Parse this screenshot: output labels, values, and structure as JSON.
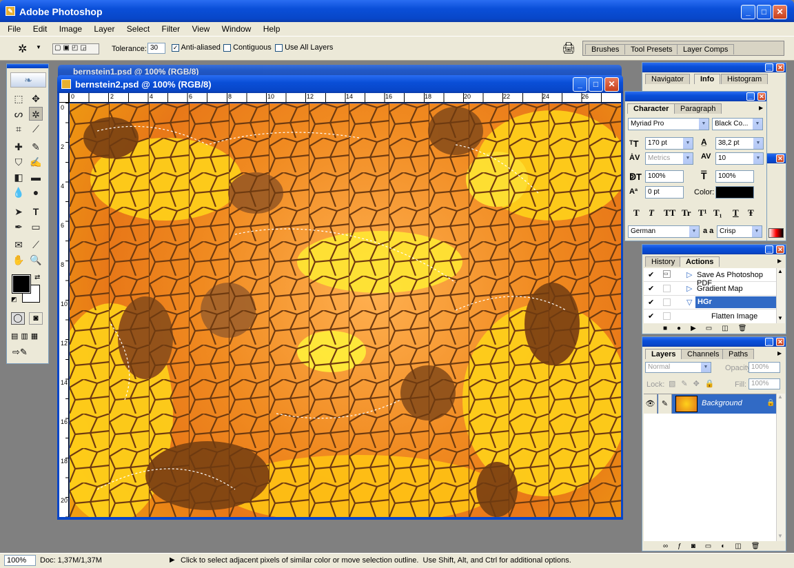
{
  "app": {
    "title": "Adobe Photoshop"
  },
  "menu": [
    "File",
    "Edit",
    "Image",
    "Layer",
    "Select",
    "Filter",
    "View",
    "Window",
    "Help"
  ],
  "options": {
    "tolerance_label": "Tolerance:",
    "tolerance_value": "30",
    "anti_aliased": "Anti-aliased",
    "contiguous": "Contiguous",
    "use_all_layers": "Use All Layers"
  },
  "palette_well": [
    "Brushes",
    "Tool Presets",
    "Layer Comps"
  ],
  "doc_back": {
    "title": "bernstein1.psd @ 100% (RGB/8)"
  },
  "doc": {
    "title": "bernstein2.psd @ 100% (RGB/8)",
    "ruler_h": [
      "0",
      "2",
      "4",
      "6",
      "8",
      "10",
      "12",
      "14",
      "16",
      "18",
      "20",
      "22",
      "24",
      "26"
    ],
    "ruler_v": [
      "0",
      "2",
      "4",
      "6",
      "8",
      "10",
      "12",
      "14",
      "16",
      "18",
      "20"
    ]
  },
  "navigator": {
    "tabs": [
      "Navigator",
      "Info",
      "Histogram"
    ]
  },
  "character": {
    "tabs": [
      "Character",
      "Paragraph"
    ],
    "font": "Myriad Pro",
    "style": "Black Co...",
    "size": "170 pt",
    "leading": "38,2 pt",
    "kerning": "Metrics",
    "tracking": "10",
    "vscale": "100%",
    "hscale": "100%",
    "baseline": "0 pt",
    "color_label": "Color:",
    "language": "German",
    "aa_label": "a a",
    "aa": "Crisp",
    "type_styles": [
      "T",
      "T",
      "TT",
      "Tr",
      "T¹",
      "T₁",
      "T",
      "Ŧ"
    ]
  },
  "actions": {
    "tabs": [
      "History",
      "Actions"
    ],
    "items": [
      "Save As Photoshop PDF",
      "Gradient Map",
      "HGr",
      "Flatten Image"
    ]
  },
  "layers": {
    "tabs": [
      "Layers",
      "Channels",
      "Paths"
    ],
    "blend": "Normal",
    "opacity_label": "Opacity:",
    "opacity": "100%",
    "lock_label": "Lock:",
    "fill_label": "Fill:",
    "fill": "100%",
    "layer_name": "Background"
  },
  "status": {
    "zoom": "100%",
    "doc": "Doc: 1,37M/1,37M",
    "message": "Click to select adjacent pixels of similar color or move selection outline.  Use Shift, Alt, and Ctrl for additional options."
  },
  "colors": {
    "xp_blue": "#0a4fd8",
    "panel_bg": "#ece9d8",
    "selected": "#316ac5"
  }
}
